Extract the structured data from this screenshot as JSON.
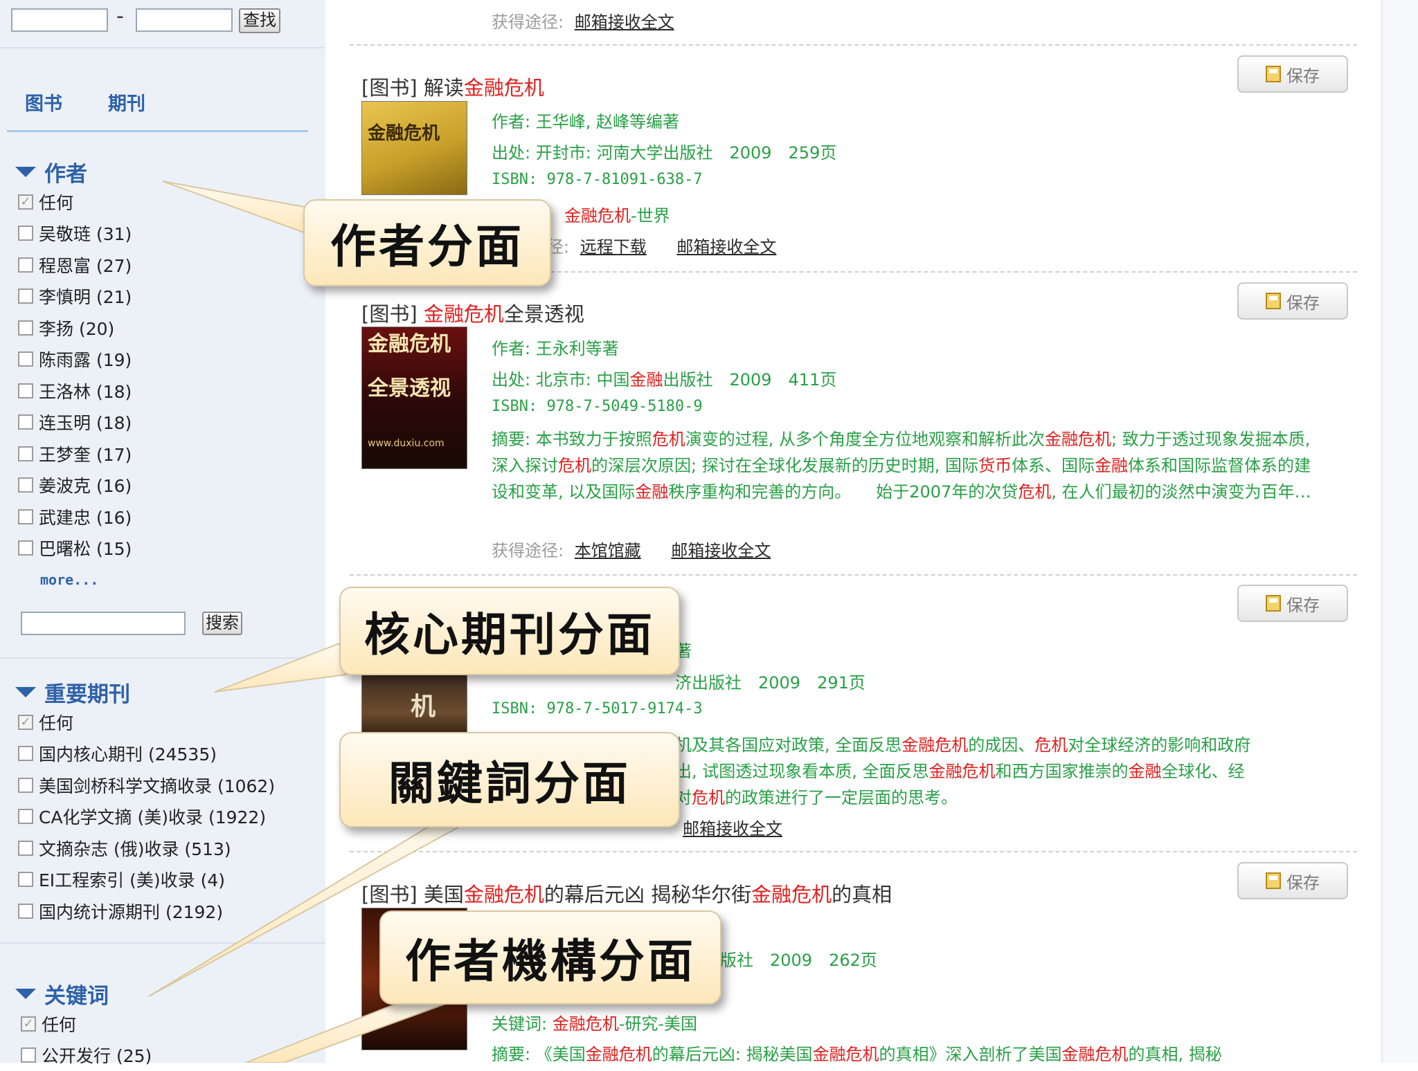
{
  "search": {
    "button_label": "查找"
  },
  "tabs": [
    {
      "label": "图书"
    },
    {
      "label": "期刊"
    }
  ],
  "facets": {
    "author": {
      "title": "作者",
      "items": [
        {
          "label": "任何",
          "checked": true
        },
        {
          "label": "吴敬琏 (31)"
        },
        {
          "label": "程恩富 (27)"
        },
        {
          "label": "李慎明 (21)"
        },
        {
          "label": "李扬 (20)"
        },
        {
          "label": "陈雨露 (19)"
        },
        {
          "label": "王洛林 (18)"
        },
        {
          "label": "连玉明 (18)"
        },
        {
          "label": "王梦奎 (17)"
        },
        {
          "label": "姜波克 (16)"
        },
        {
          "label": "武建忠 (16)"
        },
        {
          "label": "巴曙松 (15)"
        }
      ],
      "more": "more...",
      "search_button": "搜索"
    },
    "journal": {
      "title": "重要期刊",
      "items": [
        {
          "label": "任何",
          "checked": true
        },
        {
          "label": "国内核心期刊 (24535)"
        },
        {
          "label": "美国剑桥科学文摘收录 (1062)"
        },
        {
          "label": "CA化学文摘 (美)收录 (1922)"
        },
        {
          "label": "文摘杂志 (俄)收录 (513)"
        },
        {
          "label": "EI工程索引 (美)收录 (4)"
        },
        {
          "label": "国内统计源期刊 (2192)"
        }
      ]
    },
    "keyword": {
      "title": "关键词",
      "items": [
        {
          "label": "任何",
          "checked": true
        },
        {
          "label": "公开发行 (25)"
        }
      ]
    }
  },
  "results": {
    "save_label": "保存",
    "r0": {
      "access_label": "获得途径:",
      "link1": "邮箱接收全文"
    },
    "r1": {
      "tag": "[图书]",
      "title_pre": "解读",
      "title_hl": "金融危机",
      "author_label": "作者:",
      "author": "王华峰, 赵峰等编著",
      "source_label": "出处:",
      "source": "开封市: 河南大学出版社　2009　259页",
      "isbn_label": "ISBN:",
      "isbn": "978-7-81091-638-7",
      "kw_hl": "金融危机",
      "kw_rest": "-世界",
      "access_tail": "径:",
      "link1": "远程下载",
      "link2": "邮箱接收全文",
      "cover": "金融危机"
    },
    "r2": {
      "tag": "[图书]",
      "title_hl": "金融危机",
      "title_post": "全景透视",
      "author_label": "作者:",
      "author": "王永利等著",
      "source_label": "出处:",
      "source_a": "北京市: 中国",
      "source_hl": "金融",
      "source_b": "出版社　2009　411页",
      "isbn_label": "ISBN:",
      "isbn": "978-7-5049-5180-9",
      "abstract_label": "摘要:",
      "abstract_1": "本书致力于按照",
      "abstract_hl1": "危机",
      "abstract_2": "演变的过程, 从多个角度全方位地观察和解析此次",
      "abstract_hl2": "金融危机",
      "abstract_3": "; 致力于透过现象发掘本质, 深入探讨",
      "abstract_hl3": "危机",
      "abstract_4": "的深层次原因; 探讨在全球化发展新的历史时期, 国际",
      "abstract_hl4": "货币",
      "abstract_5": "体系、国际",
      "abstract_hl5": "金融",
      "abstract_6": "体系和国际监督体系的建设和变革, 以及国际",
      "abstract_hl6": "金融",
      "abstract_7": "秩序重构和完善的方向。　　始于2007年的次贷",
      "abstract_hl7": "危机",
      "abstract_8": ", 在人们最初的淡然中演变为百年…",
      "access_label": "获得途径:",
      "link1": "本馆馆藏",
      "link2": "邮箱接收全文",
      "cover_line1": "金融危机",
      "cover_line2": "全景透视",
      "cover_small": "www.duxiu.com"
    },
    "r3": {
      "author_tail": "著",
      "source": "济出版社　2009　291页",
      "isbn_label": "ISBN:",
      "isbn": "978-7-5017-9174-3",
      "abs1_a": "机及其各国应对政策, 全面反思",
      "abs1_hl": "金融危机",
      "abs1_b": "的成因、",
      "abs1_hl2": "危机",
      "abs1_c": "对全球经济的影响和政府",
      "abs2_a": "出, 试图透过现象看本质, 全面反思",
      "abs2_hl": "金融危机",
      "abs2_b": "和西方国家推崇的",
      "abs2_hl2": "金融",
      "abs2_c": "全球化、经",
      "abs3_a": "对",
      "abs3_hl": "危机",
      "abs3_b": "的政策进行了一定层面的思考。",
      "link2": "邮箱接收全文",
      "cover": "机"
    },
    "r4": {
      "tag": "[图书]",
      "title_a": "美国",
      "title_hl1": "金融危机",
      "title_b": "的幕后元凶  揭秘华尔街",
      "title_hl2": "金融危机",
      "title_c": "的真相",
      "source": "版社　2009　262页",
      "kw_label": "关键词:",
      "kw_hl": "金融危机",
      "kw_rest": "-研究-美国",
      "abstract_label": "摘要:",
      "abs_a": "《美国",
      "abs_hl1": "金融危机",
      "abs_b": "的幕后元凶: 揭秘美国",
      "abs_hl2": "金融危机",
      "abs_c": "的真相》深入剖析了美国",
      "abs_hl3": "金融危机",
      "abs_d": "的真相, 揭秘"
    }
  },
  "callouts": {
    "author": "作者分面",
    "journal": "核心期刊分面",
    "keyword": "關鍵詞分面",
    "org": "作者機構分面"
  },
  "colors": {
    "highlight": "#e0201e",
    "meta_green": "#29a046",
    "facet_blue": "#2e61a8",
    "callout_fill": "#fde7b9"
  }
}
